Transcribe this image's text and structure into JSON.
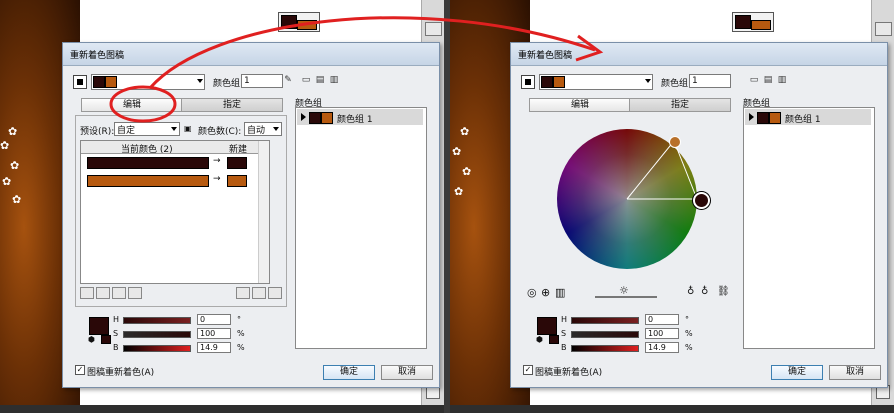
{
  "dialog": {
    "title": "重新着色图稿",
    "color_group_label": "颜色组",
    "color_group_name": "1",
    "tabs": [
      "编辑",
      "指定"
    ],
    "groups_title": "颜色组",
    "groups": [
      "颜色组 1"
    ],
    "recolor_label": "图稿重新着色(A)",
    "ok_label": "确定",
    "cancel_label": "取消",
    "hsb": {
      "h_label": "H",
      "h_value": "0",
      "h_unit": "°",
      "s_label": "S",
      "s_value": "100",
      "s_unit": "%",
      "b_label": "B",
      "b_value": "14.9",
      "b_unit": "%"
    }
  },
  "left_panel": {
    "preset_label": "预设(R):",
    "preset_value": "自定",
    "colors_label": "颜色数(C):",
    "colors_value": "自动",
    "table_header_current": "当前颜色 (2)",
    "table_header_new": "新建",
    "rows": [
      {
        "current": "#2a0808",
        "new": "#2a0808"
      },
      {
        "current": "#b75a10",
        "new": "#b75a10"
      }
    ],
    "active_tab": "编辑"
  },
  "right_panel": {
    "active_tab": "编辑",
    "wheel_handles": [
      "#b8702a",
      "#2a0808"
    ]
  },
  "colors": {
    "dark_red": "#2a0808",
    "orange": "#b75a10",
    "annotation_red": "#e02020"
  }
}
